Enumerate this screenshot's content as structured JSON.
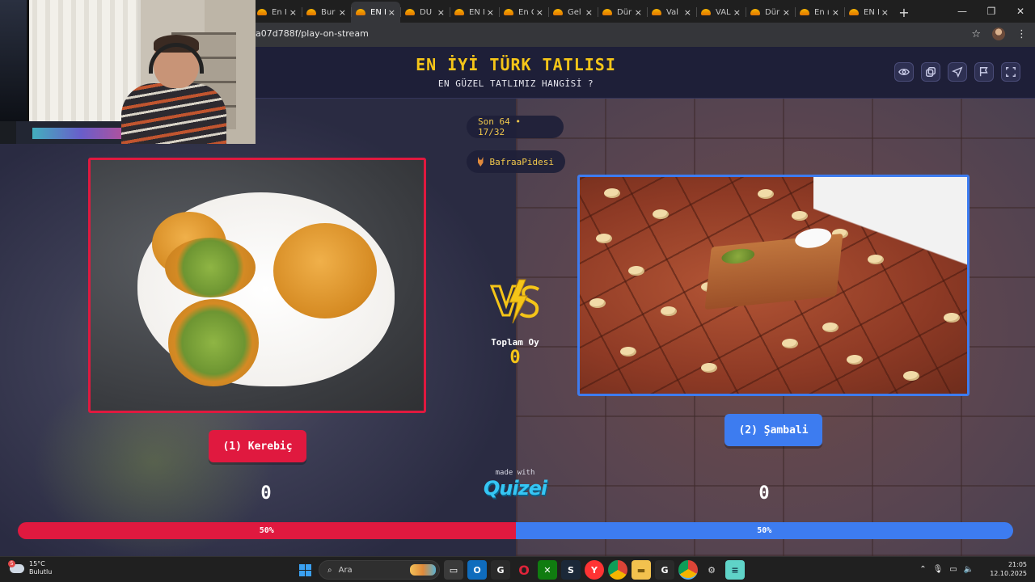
{
  "browser": {
    "tabs": [
      {
        "label": "En İ"
      },
      {
        "label": "Bur"
      },
      {
        "label": "EN İ",
        "active": true
      },
      {
        "label": "DÜ"
      },
      {
        "label": "EN İ"
      },
      {
        "label": "En G"
      },
      {
        "label": "Gel"
      },
      {
        "label": "Dür"
      },
      {
        "label": "Val"
      },
      {
        "label": "VAL"
      },
      {
        "label": "Dür"
      },
      {
        "label": "En ı"
      },
      {
        "label": "EN İ"
      }
    ],
    "url": "a07d788f/play-on-stream",
    "new_tab_symbol": "+",
    "close_symbol": "×"
  },
  "quiz": {
    "title": "EN İYİ TÜRK TATLISI",
    "subtitle": "EN GÜZEL TATLIMIZ HANGİSİ ?",
    "round": "Son 64 • 17/32",
    "user": "BafraaPidesi",
    "total_label": "Toplam Oy",
    "total_votes": "0",
    "made_with": "made with",
    "brand": "Quizei",
    "accent_color": "#f5c518",
    "left": {
      "label": "(1) Kerebiç",
      "votes": "0",
      "percent_label": "50%",
      "share": 0.5,
      "color": "#e0193f"
    },
    "right": {
      "label": "(2) Şambali",
      "votes": "0",
      "percent_label": "50%",
      "share": 0.5,
      "color": "#3d7cf0"
    },
    "header_buttons": [
      "eye-icon",
      "copy-icon",
      "send-icon",
      "flag-icon",
      "fullscreen-icon"
    ]
  },
  "taskbar": {
    "weather_temp": "15°C",
    "weather_desc": "Bulutlu",
    "weather_badge": "5",
    "search_placeholder": "Ara",
    "time": "21:05",
    "date": "12.10.2025"
  }
}
